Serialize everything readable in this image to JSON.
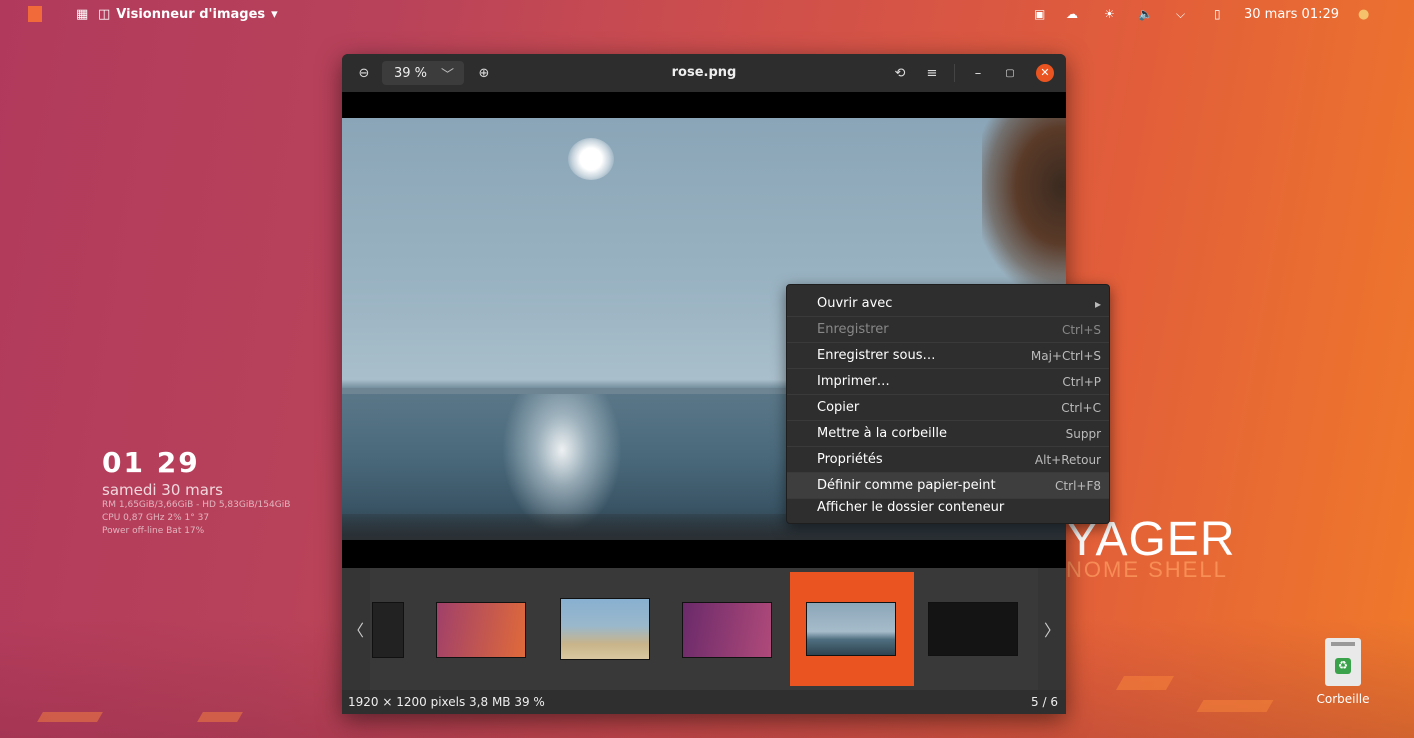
{
  "topbar": {
    "app_name": "Visionneur d'images",
    "datetime": "30 mars  01:29"
  },
  "conky": {
    "time": "01 29",
    "date": "samedi 30 mars",
    "mem_line": "RM 1,65GiB/3,66GiB - HD 5,83GiB/154GiB",
    "cpu_line": "CPU 0,87 GHz 2% 1° 37",
    "power_line": "Power off-line Bat 17%"
  },
  "wallpaper_text": {
    "big": "YAGER",
    "sub": "NOME SHELL"
  },
  "trash": {
    "label": "Corbeille"
  },
  "viewer": {
    "zoom_value": "39 %",
    "title": "rose.png",
    "status_info": "1920 × 1200 pixels  3,8 MB   39 %",
    "position": "5 / 6",
    "selected_thumbnail_index": 5,
    "thumbnail_count": 6
  },
  "context_menu": {
    "items": [
      {
        "label": "Ouvrir avec",
        "accel": "",
        "submenu": true,
        "enabled": true
      },
      {
        "label": "Enregistrer",
        "accel": "Ctrl+S",
        "enabled": false
      },
      {
        "label": "Enregistrer sous…",
        "accel": "Maj+Ctrl+S",
        "enabled": true
      },
      {
        "label": "Imprimer…",
        "accel": "Ctrl+P",
        "enabled": true
      },
      {
        "label": "Copier",
        "accel": "Ctrl+C",
        "enabled": true
      },
      {
        "label": "Mettre à la corbeille",
        "accel": "Suppr",
        "enabled": true
      },
      {
        "label": "Propriétés",
        "accel": "Alt+Retour",
        "enabled": true
      },
      {
        "label": "Définir comme papier-peint",
        "accel": "Ctrl+F8",
        "enabled": true,
        "highlighted": true
      },
      {
        "label": "Afficher le dossier conteneur",
        "accel": "",
        "enabled": true
      }
    ]
  },
  "colors": {
    "accent": "#e95420",
    "menu_bg": "#2e2e2e",
    "window_bg": "#2b2b2b"
  }
}
